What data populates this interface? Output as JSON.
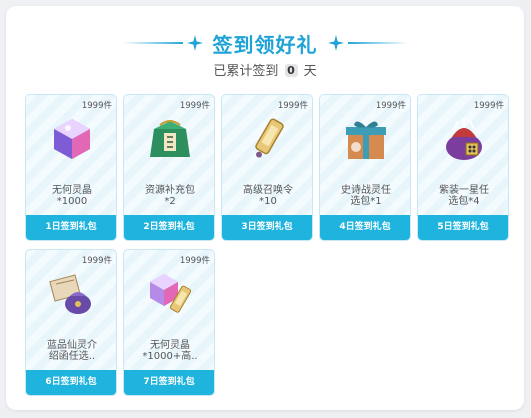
{
  "header": {
    "title": "签到领好礼",
    "subtitle_prefix": "已累计签到",
    "signed_days": "0",
    "subtitle_suffix": "天"
  },
  "colors": {
    "accent": "#1fa3d6",
    "button": "#1fb4de"
  },
  "rewards": [
    {
      "stock": "1999件",
      "name": "无何灵晶\n*1000",
      "button": "1日签到礼包",
      "icon": "crystal-icon"
    },
    {
      "stock": "1999件",
      "name": "资源补充包\n*2",
      "button": "2日签到礼包",
      "icon": "resource-pack-icon"
    },
    {
      "stock": "1999件",
      "name": "高级召唤令\n*10",
      "button": "3日签到礼包",
      "icon": "summon-token-icon"
    },
    {
      "stock": "1999件",
      "name": "史诗战灵任\n选包*1",
      "button": "4日签到礼包",
      "icon": "gift-box-icon"
    },
    {
      "stock": "1999件",
      "name": "紫装一星任\n选包*4",
      "button": "5日签到礼包",
      "icon": "purple-bag-icon"
    },
    {
      "stock": "1999件",
      "name": "蓝品仙灵介\n绍函任选..",
      "button": "6日签到礼包",
      "icon": "letter-bag-icon"
    },
    {
      "stock": "1999件",
      "name": "无何灵晶\n*1000+高..",
      "button": "7日签到礼包",
      "icon": "crystal-token-icon"
    }
  ]
}
